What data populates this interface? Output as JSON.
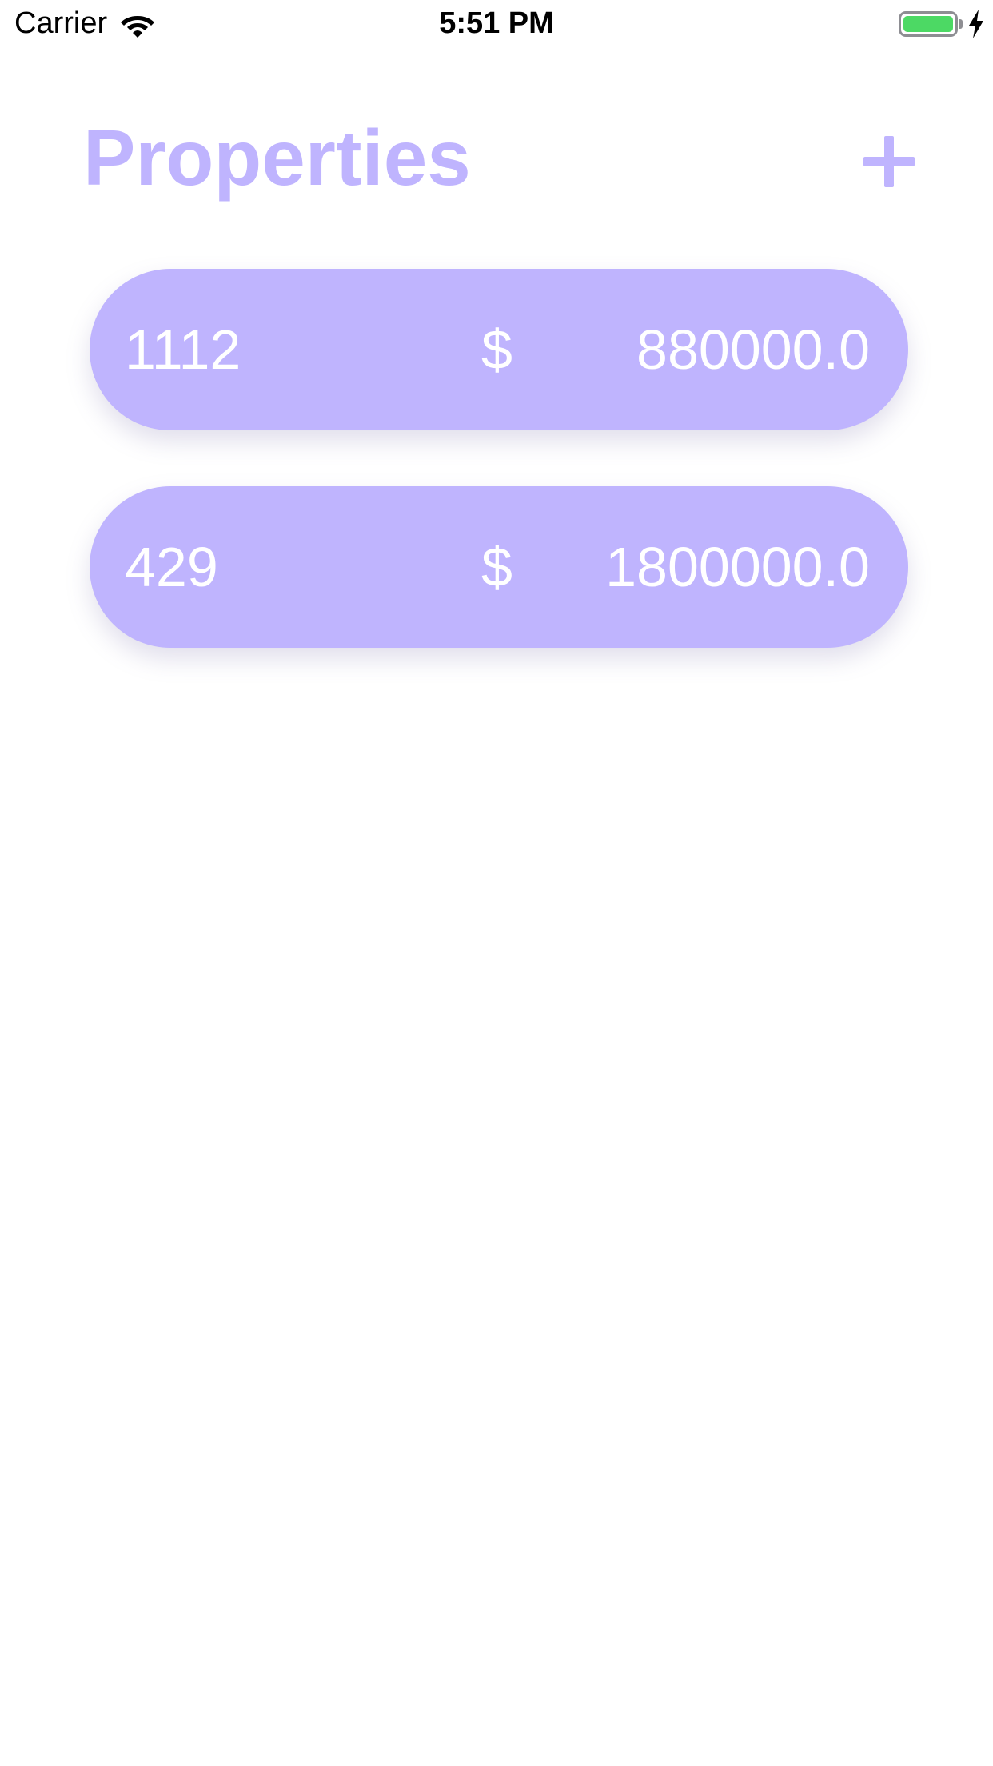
{
  "status_bar": {
    "carrier": "Carrier",
    "time": "5:51 PM",
    "battery_level": 1.0,
    "charging": true
  },
  "header": {
    "title": "Properties",
    "add_icon": "plus-icon"
  },
  "properties": [
    {
      "id": "1112",
      "currency": "$",
      "price": "880000.0"
    },
    {
      "id": "429",
      "currency": "$",
      "price": "1800000.0"
    }
  ],
  "colors": {
    "accent": "#bfb4fe",
    "battery_green": "#4cd964",
    "background": "#ffffff",
    "card_text": "#ffffff"
  }
}
